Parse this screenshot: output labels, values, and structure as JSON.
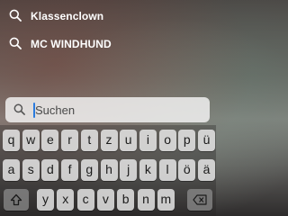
{
  "suggestions": [
    {
      "label": "Klassenclown",
      "icon": "search-icon"
    },
    {
      "label": "MC WINDHUND",
      "icon": "search-icon"
    }
  ],
  "search": {
    "placeholder": "Suchen",
    "icon": "search-icon",
    "accent_color": "#2a7bde"
  },
  "keyboard": {
    "row1": [
      "q",
      "w",
      "e",
      "r",
      "t",
      "z",
      "u",
      "i",
      "o",
      "p",
      "ü"
    ],
    "row2": [
      "a",
      "s",
      "d",
      "f",
      "g",
      "h",
      "j",
      "k",
      "l",
      "ö",
      "ä"
    ],
    "row3": [
      "y",
      "x",
      "c",
      "v",
      "b",
      "n",
      "m"
    ],
    "shift_icon": "shift-icon",
    "delete_icon": "delete-icon"
  }
}
